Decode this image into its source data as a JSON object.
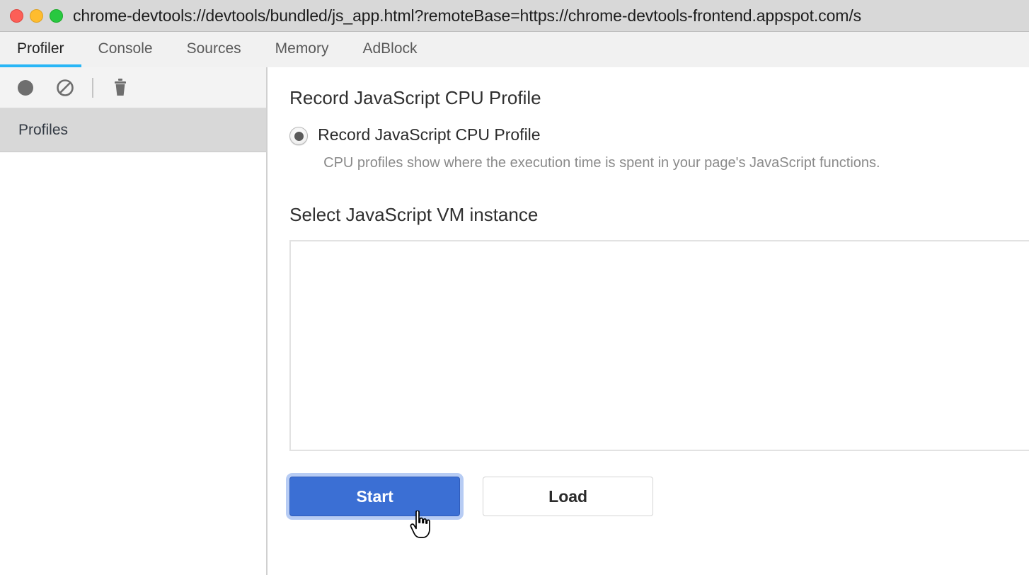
{
  "window": {
    "title": "chrome-devtools://devtools/bundled/js_app.html?remoteBase=https://chrome-devtools-frontend.appspot.com/s",
    "controls": {
      "close": "close-button",
      "minimize": "minimize-button",
      "maximize": "maximize-button"
    }
  },
  "tabs": [
    {
      "label": "Profiler",
      "active": true
    },
    {
      "label": "Console",
      "active": false
    },
    {
      "label": "Sources",
      "active": false
    },
    {
      "label": "Memory",
      "active": false
    },
    {
      "label": "AdBlock",
      "active": false
    }
  ],
  "sidebar": {
    "toolbar": [
      {
        "icon": "record-icon",
        "title": "Start CPU profiling"
      },
      {
        "icon": "clear-all-icon",
        "title": "Clear all profiles"
      },
      {
        "icon": "trash-icon",
        "title": "Delete profile"
      }
    ],
    "header": "Profiles",
    "items": []
  },
  "main": {
    "record_section": {
      "title": "Record JavaScript CPU Profile",
      "radio": {
        "label": "Record JavaScript CPU Profile",
        "checked": true
      },
      "description": "CPU profiles show where the execution time is spent in your page's JavaScript functions."
    },
    "vm_section": {
      "title": "Select JavaScript VM instance",
      "instances": []
    },
    "buttons": {
      "start": "Start",
      "load": "Load"
    }
  },
  "colors": {
    "accent_tab": "#29b6f6",
    "primary_button": "#3b6fd4",
    "focus_ring": "#b7ccf4",
    "titlebar_bg": "#d8d8d8",
    "profiles_header_bg": "#d8d8d8"
  }
}
